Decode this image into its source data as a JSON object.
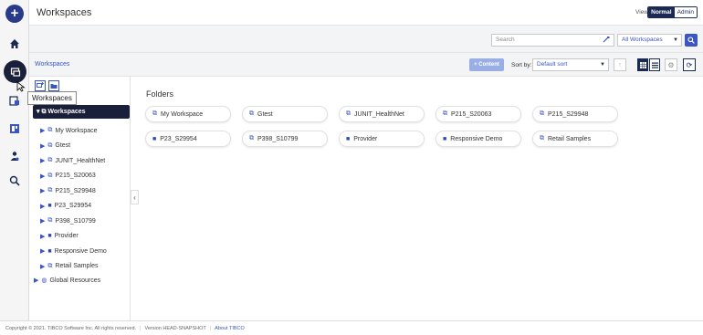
{
  "header": {
    "title": "Workspaces",
    "view_label": "View",
    "view_normal": "Normal",
    "view_admin": "Admin"
  },
  "search": {
    "placeholder": "Search",
    "scope": "All Workspaces"
  },
  "toolbar": {
    "breadcrumb": "Workspaces",
    "content_button": "+ Content",
    "sort_label": "Sort by:",
    "sort_value": "Default sort"
  },
  "rail": {
    "tooltip": "Workspaces"
  },
  "tree": {
    "root": "Workspaces",
    "items": [
      {
        "label": "My Workspace",
        "kind": "workspace"
      },
      {
        "label": "Gtest",
        "kind": "workspace"
      },
      {
        "label": "JUNIT_HealthNet",
        "kind": "workspace"
      },
      {
        "label": "P215_S20063",
        "kind": "workspace"
      },
      {
        "label": "P215_S29948",
        "kind": "workspace"
      },
      {
        "label": "P23_S29954",
        "kind": "folder"
      },
      {
        "label": "P398_S10799",
        "kind": "workspace"
      },
      {
        "label": "Provider",
        "kind": "folder"
      },
      {
        "label": "Responsive Demo",
        "kind": "folder"
      },
      {
        "label": "Retail Samples",
        "kind": "workspace"
      }
    ],
    "global": "Global Resources"
  },
  "main": {
    "folders_title": "Folders",
    "cards": [
      {
        "label": "My Workspace",
        "kind": "workspace"
      },
      {
        "label": "Gtest",
        "kind": "workspace"
      },
      {
        "label": "JUNIT_HealthNet",
        "kind": "workspace"
      },
      {
        "label": "P215_S20063",
        "kind": "workspace"
      },
      {
        "label": "P215_S29948",
        "kind": "workspace"
      },
      {
        "label": "P23_S29954",
        "kind": "folder"
      },
      {
        "label": "P398_S10799",
        "kind": "workspace"
      },
      {
        "label": "Provider",
        "kind": "folder"
      },
      {
        "label": "Responsive Demo",
        "kind": "folder"
      },
      {
        "label": "Retail Samples",
        "kind": "workspace"
      }
    ]
  },
  "footer": {
    "copyright": "Copyright © 2021. TIBCO Software Inc. All rights reserved.",
    "sep": "|",
    "version": "Version HEAD-SNAPSHOT",
    "about": "About TIBCO"
  },
  "colors": {
    "accent": "#3a55c4",
    "dark": "#1a1f3a",
    "navy": "#1a2a55"
  }
}
